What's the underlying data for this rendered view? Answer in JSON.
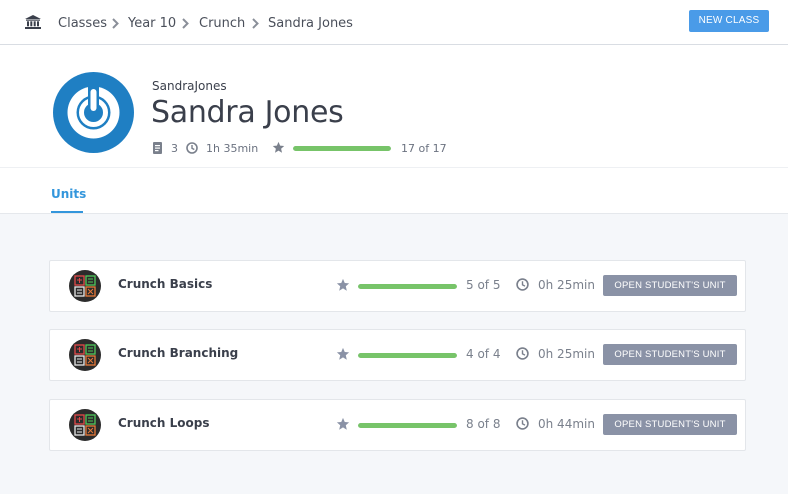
{
  "breadcrumb": {
    "items": [
      "Classes",
      "Year 10",
      "Crunch",
      "Sandra Jones"
    ]
  },
  "toolbar": {
    "new_class_label": "NEW CLASS"
  },
  "profile": {
    "username": "SandraJones",
    "full_name": "Sandra Jones",
    "units_count": "3",
    "time_spent": "1h 35min",
    "progress_text": "17 of 17",
    "progress_fraction": 1.0
  },
  "tabs": [
    {
      "label": "Units",
      "active": true
    }
  ],
  "units": [
    {
      "name": "Crunch Basics",
      "progress_text": "5 of 5",
      "progress_fraction": 1.0,
      "time": "0h 25min",
      "button_label": "OPEN STUDENT'S UNIT"
    },
    {
      "name": "Crunch Branching",
      "progress_text": "4 of 4",
      "progress_fraction": 1.0,
      "time": "0h 25min",
      "button_label": "OPEN STUDENT'S UNIT"
    },
    {
      "name": "Crunch Loops",
      "progress_text": "8 of 8",
      "progress_fraction": 1.0,
      "time": "0h 44min",
      "button_label": "OPEN STUDENT'S UNIT"
    }
  ],
  "colors": {
    "accent": "#4a9be8",
    "tab_active": "#3396dc",
    "progress": "#77c469",
    "button_gray": "#8a92a6",
    "avatar_blue": "#1f7fc3"
  },
  "icons": {
    "home": "institution-icon",
    "separator": "chevron-right-icon",
    "units": "document-icon",
    "time": "clock-icon",
    "progress": "star-icon",
    "unit": "crunch-unit-icon"
  }
}
